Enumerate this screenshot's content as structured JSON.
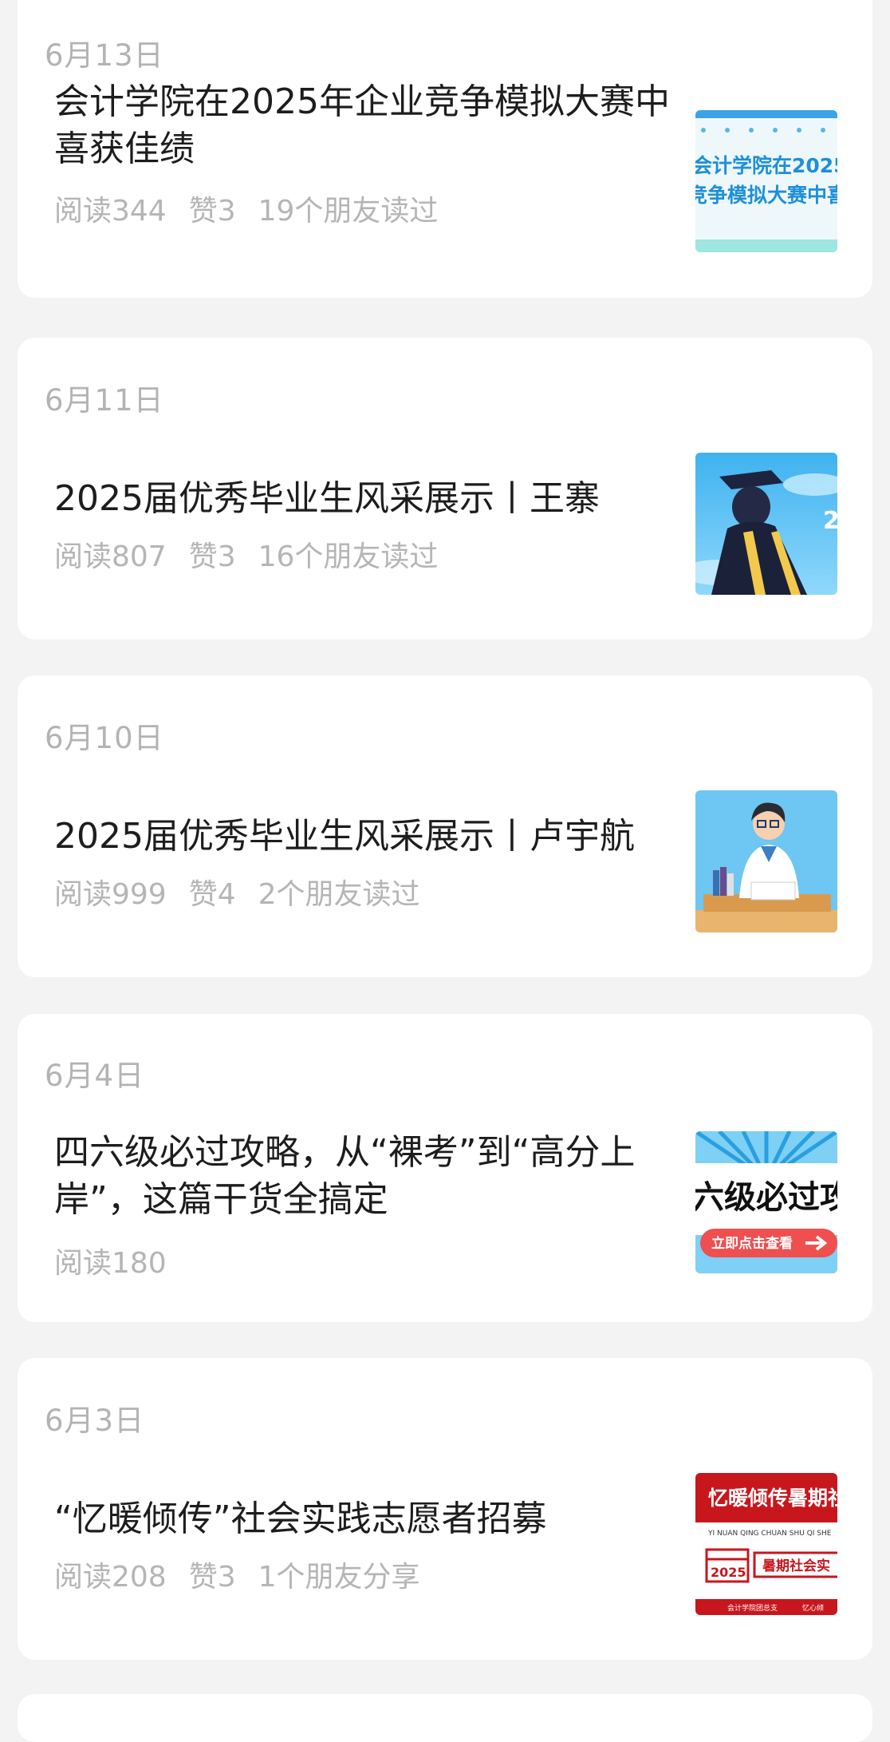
{
  "articles": [
    {
      "date": "6月13日",
      "title": "会计学院在2025年企业竞争模拟大赛中喜获佳绩",
      "reads": "阅读344",
      "likes": "赞3",
      "friends": "19个朋友读过",
      "thumb": {
        "line1": "会计学院在2025",
        "line2": "竞争模拟大赛中喜"
      }
    },
    {
      "date": "6月11日",
      "title": "2025届优秀毕业生风采展示丨王寨",
      "reads": "阅读807",
      "likes": "赞3",
      "friends": "16个朋友读过",
      "thumb": {
        "text": "2"
      }
    },
    {
      "date": "6月10日",
      "title": "2025届优秀毕业生风采展示丨卢宇航",
      "reads": "阅读999",
      "likes": "赞4",
      "friends": "2个朋友读过"
    },
    {
      "date": "6月4日",
      "title": "四六级必过攻略，从“裸考”到“高分上岸”，这篇干货全搞定",
      "reads": "阅读180",
      "thumb": {
        "headline": "六级必过攻",
        "button": "立即点击查看"
      }
    },
    {
      "date": "6月3日",
      "title": "“忆暖倾传”社会实践志愿者招募",
      "reads": "阅读208",
      "likes": "赞3",
      "friends": "1个朋友分享",
      "thumb": {
        "headline": "忆暖倾传暑期社",
        "pinyin": "YI NUAN QING CHUAN SHU QI SHE",
        "year": "2025",
        "tag": "暑期社会实",
        "footer_left": "会计学院团总支",
        "footer_right": "忆心倾"
      }
    }
  ]
}
